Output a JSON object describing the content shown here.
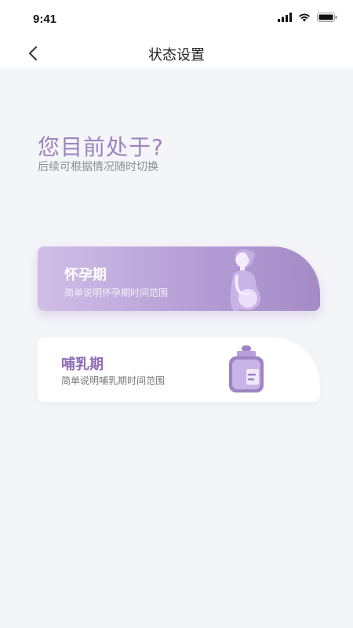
{
  "status_bar": {
    "time": "9:41"
  },
  "nav": {
    "title": "状态设置",
    "back_icon": "chevron-left-icon"
  },
  "prompt": {
    "heading": "您目前处于?",
    "subheading": "后续可根据情况随时切换"
  },
  "options": [
    {
      "title": "怀孕期",
      "description": "简单说明怀孕期时间范围",
      "icon": "pregnant-woman-icon",
      "selected": true
    },
    {
      "title": "哺乳期",
      "description": "简单说明哺乳期时间范围",
      "icon": "baby-bottle-icon",
      "selected": false
    }
  ],
  "colors": {
    "accent": "#9c83bf",
    "card_gradient_start": "#d0bfe8",
    "card_gradient_end": "#a48bc6",
    "background": "#f4f5f8"
  }
}
